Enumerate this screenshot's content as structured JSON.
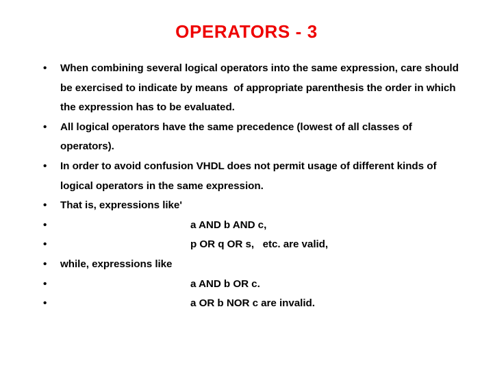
{
  "slide": {
    "title": "OPERATORS - 3",
    "title_color": "#ee0000",
    "background_color": "#ffffff",
    "text_color": "#000000",
    "bullet_marker": "•",
    "bullets": [
      {
        "marker": "•",
        "text": "When combining several logical operators into the same expression, care should be exercised to indicate by means  of appropriate parenthesis the order in which the expression has to be evaluated.",
        "indented": false
      },
      {
        "marker": "•",
        "text": "All logical operators have the same precedence (lowest of all classes of operators).",
        "indented": false
      },
      {
        "marker": "•",
        "text": "In order to avoid confusion VHDL does not permit usage of different kinds of logical operators in the same expression.",
        "indented": false
      },
      {
        "marker": "•",
        "text": "That is, expressions like'",
        "indented": false
      },
      {
        "marker": "•",
        "text": "a AND b AND c,",
        "indented": true
      },
      {
        "marker": "•",
        "text": "p OR q OR s,   etc. are valid,",
        "indented": true
      },
      {
        "marker": "•",
        "text": "while, expressions like",
        "indented": false
      },
      {
        "marker": "•",
        "text": "a AND b OR c.",
        "indented": true
      },
      {
        "marker": "•",
        "text": "a OR b NOR c are invalid.",
        "indented": true
      }
    ]
  }
}
